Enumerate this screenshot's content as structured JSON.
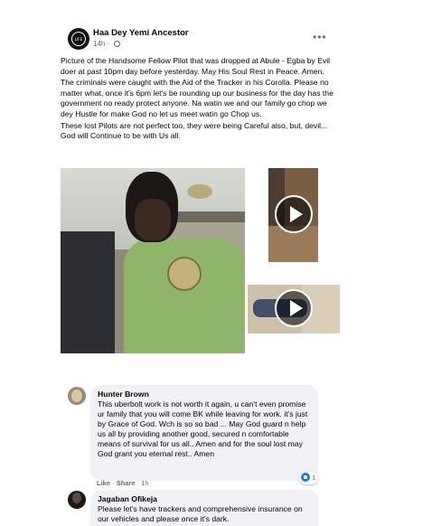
{
  "post": {
    "author": "Haa Dey Yemi Ancestor",
    "avatar_text": "LIFE",
    "time": "14h",
    "separator": "·",
    "more": "•••",
    "paragraphs": [
      "Picture of the Handsome Fellow Pilot that was dropped at Abule - Egba by Evil doer at past 10pm day before yesterday. May His Soul Rest in Peace. Amen.",
      "The criminals were caught with the Aid of the Tracker in his Corolla. Please no matter what, once it's 6pm let's be rounding up our business for the day has the government no ready protect anyone. Na watin we and our family go chop we dey Hustle for make God no let us meet watin go Chop us.",
      "These lost Pilots are not perfect too, they were being Careful also, but, devil... God will Continue to be with Us all."
    ]
  },
  "comments": [
    {
      "author": "Hunter Brown",
      "text": "This uberbolt work is not worth it again, u can't even promise ur family that you will come BK while leaving for work. it's just by Grace of God. Wch is so so bad ... May God guard n help us all by providing another good, secured n comfortable means of survival for us all.. Amen and for the soul lost may God grant you eternal rest.. Amen",
      "like": "Like",
      "share": "Share",
      "dot": "·",
      "time": "1h",
      "reaction_count": "1"
    },
    {
      "author": "Jagaban Ofikeja",
      "text": "Please let's have trackers and comprehensive insurance on our vehicles and please once it's dark."
    }
  ],
  "colors": {
    "primary_text": "#050505",
    "secondary_text": "#65676b",
    "bubble_bg": "#f0f2f5",
    "like_blue": "#1877f2"
  }
}
